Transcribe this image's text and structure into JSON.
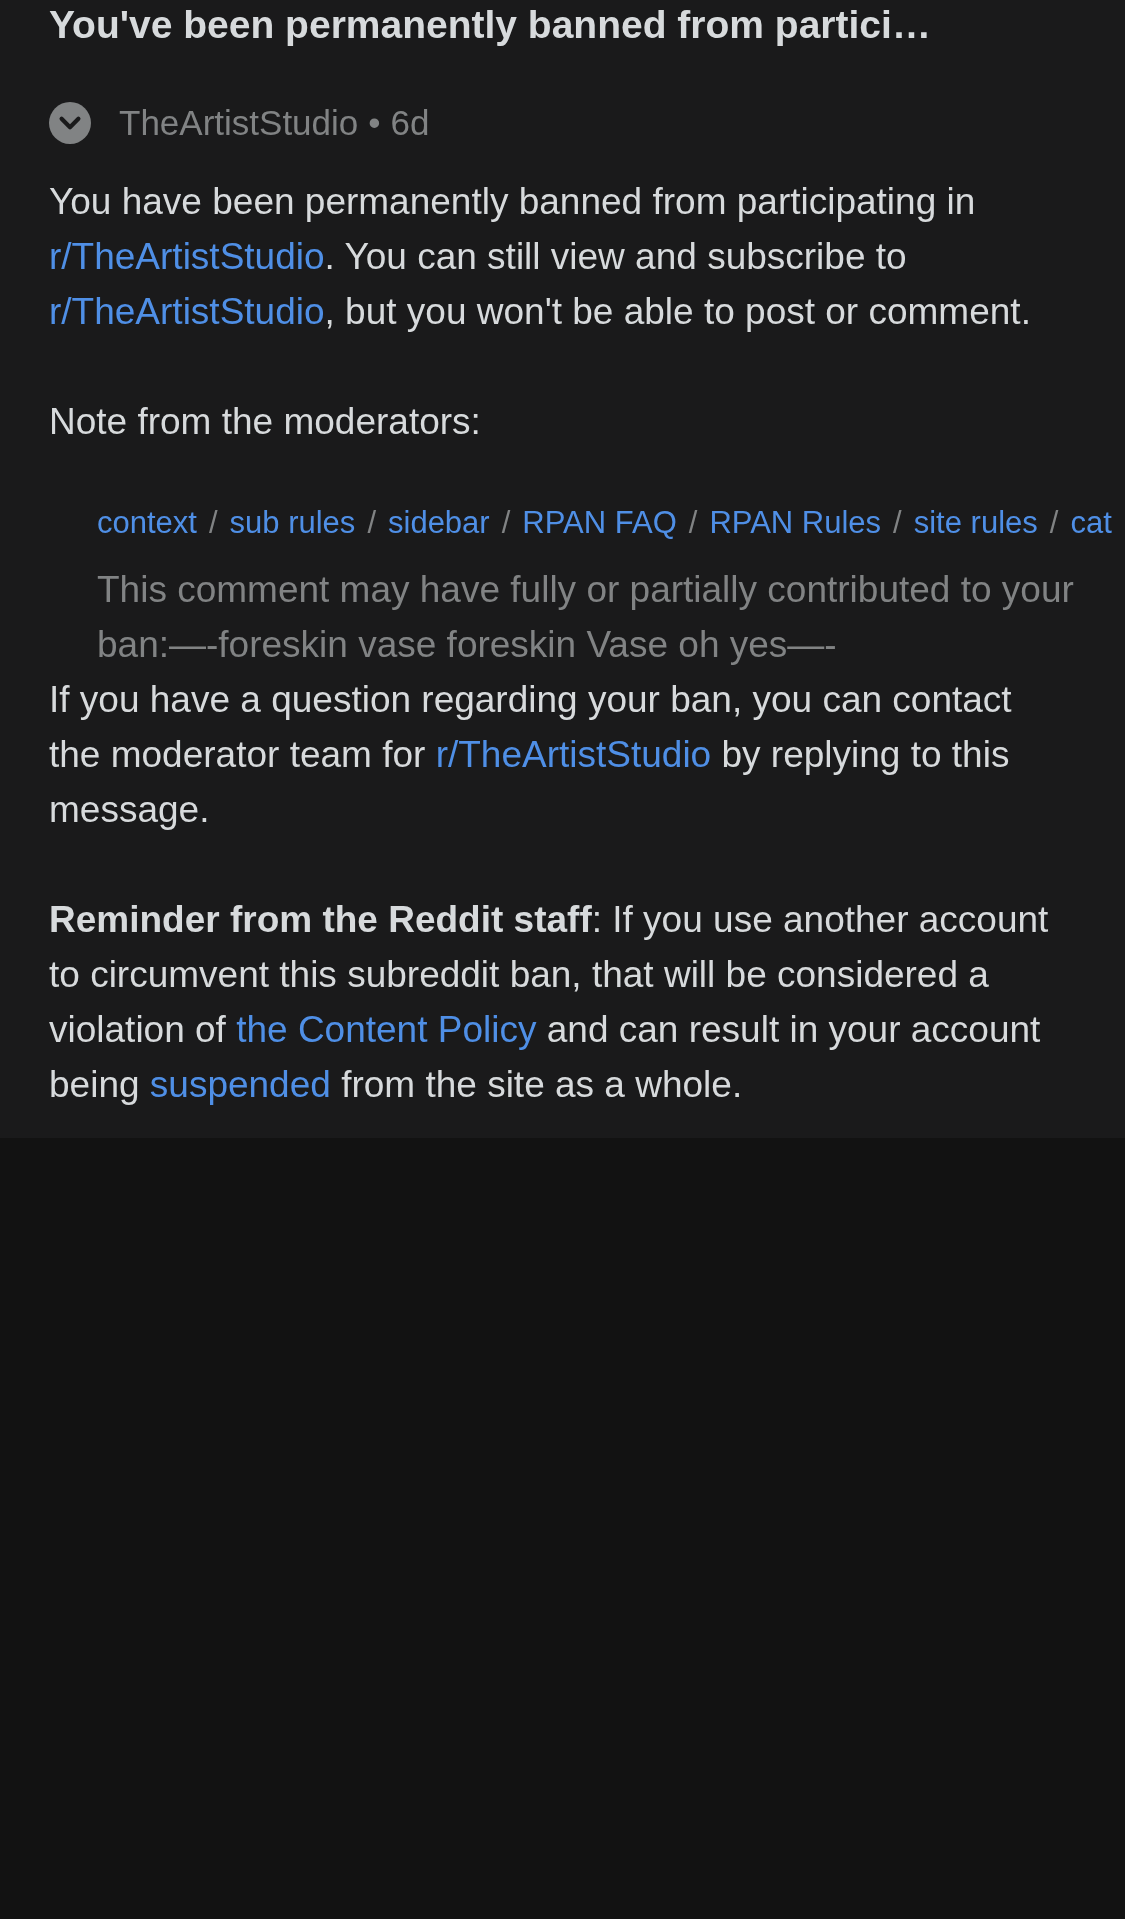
{
  "title": "You've been permanently banned from partici…",
  "meta": {
    "author": "TheArtistStudio",
    "separator": "•",
    "age": "6d"
  },
  "intro": [
    {
      "text": "You have been permanently banned from participating in ",
      "kind": "text"
    },
    {
      "text": "r/TheArtistStudio",
      "kind": "link"
    },
    {
      "text": ". You can still view and subscribe to ",
      "kind": "text"
    },
    {
      "text": "r/TheArtistStudio",
      "kind": "link"
    },
    {
      "text": ", but you won't be able to post or comment.",
      "kind": "text"
    }
  ],
  "note": "Note from the moderators:",
  "quote": {
    "links": [
      {
        "text": "context",
        "separator": "/"
      },
      {
        "text": "sub rules",
        "separator": "/"
      },
      {
        "text": "sidebar",
        "separator": "/"
      },
      {
        "text": "RPAN FAQ",
        "separator": "/"
      },
      {
        "text": "RPAN Rules",
        "separator": "/"
      },
      {
        "text": "site rules",
        "separator": "/"
      },
      {
        "text": "cat"
      }
    ],
    "comment": "This comment may have fully or partially contributed to your ban:—-foreskin vase foreskin Vase oh yes—-"
  },
  "contact": [
    {
      "text": "If you have a question regarding your ban, you can contact the moderator team for ",
      "kind": "text"
    },
    {
      "text": "r/TheArtistStudio",
      "kind": "link"
    },
    {
      "text": " by replying to this message.",
      "kind": "text"
    }
  ],
  "reminder": [
    {
      "text": "**Reminder from the Reddit staff**: If you use another account to circumvent this subreddit ban, that will be considered a violation of ",
      "kind": "text"
    },
    {
      "text": "the Content Policy",
      "kind": "link"
    },
    {
      "text": " and can result in your account being ",
      "kind": "text"
    },
    {
      "text": "suspended",
      "kind": "link"
    },
    {
      "text": " from the site as a whole.",
      "kind": "text"
    }
  ]
}
